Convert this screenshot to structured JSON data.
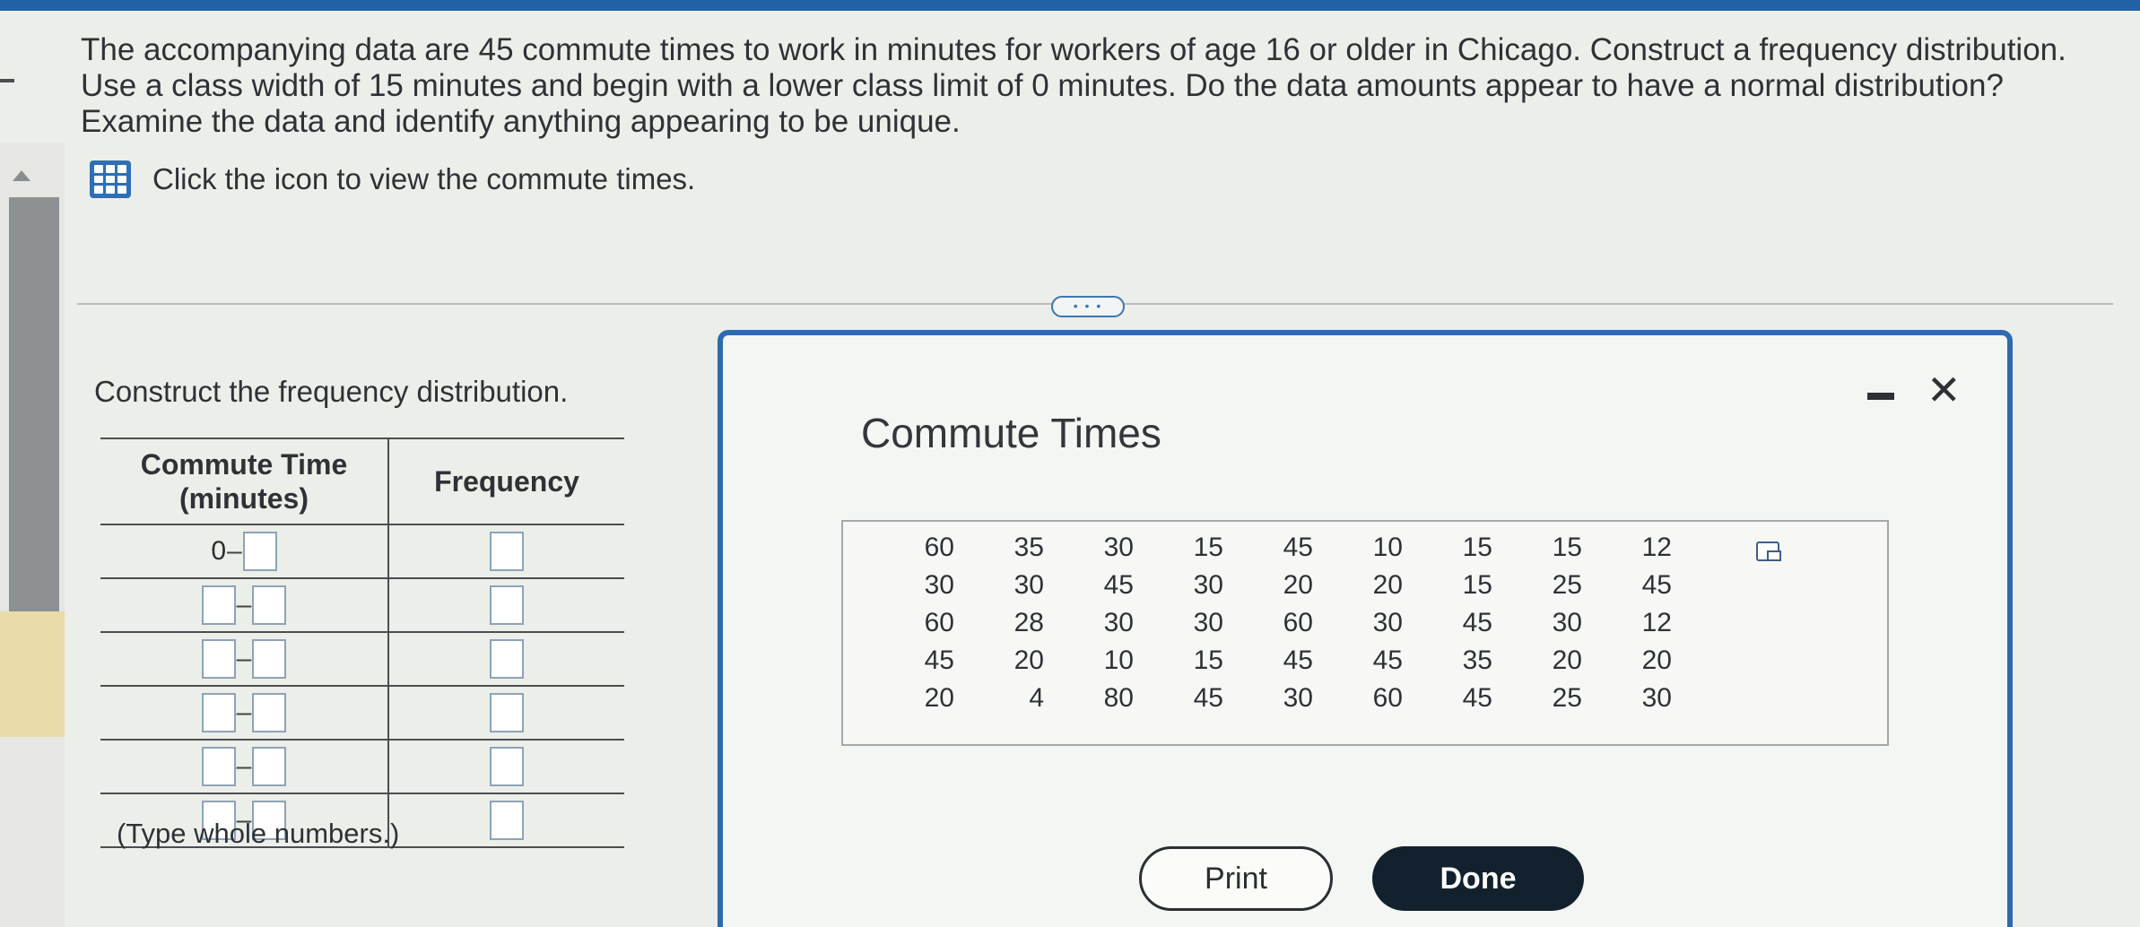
{
  "question": {
    "text": "The accompanying data are 45 commute times to work in minutes for workers of age 16 or older in Chicago. Construct a frequency distribution. Use a class width of 15 minutes and begin with a lower class limit of 0 minutes. Do the data amounts appear to have a normal distribution? Examine the data and identify anything appearing to be unique.",
    "icon_link_text": "Click the icon to view the commute times."
  },
  "more_button_label": "• • •",
  "left_panel": {
    "construct_label": "Construct the frequency distribution.",
    "table_headers": {
      "col1": "Commute Time (minutes)",
      "col2": "Frequency"
    },
    "first_lower_limit": "0",
    "hint": "(Type whole numbers.)"
  },
  "dialog": {
    "title": "Commute Times",
    "minimize_symbol": "–",
    "close_symbol": "✕",
    "rows": [
      [
        "60",
        "35",
        "30",
        "15",
        "45",
        "10",
        "15",
        "15",
        "12"
      ],
      [
        "30",
        "30",
        "45",
        "30",
        "20",
        "20",
        "15",
        "25",
        "45"
      ],
      [
        "60",
        "28",
        "30",
        "30",
        "60",
        "30",
        "45",
        "30",
        "12"
      ],
      [
        "45",
        "20",
        "10",
        "15",
        "45",
        "45",
        "35",
        "20",
        "20"
      ],
      [
        "20",
        "4",
        "80",
        "45",
        "30",
        "60",
        "45",
        "25",
        "30"
      ]
    ],
    "print_label": "Print",
    "done_label": "Done"
  },
  "colors": {
    "accent": "#2d6ab0",
    "done_bg": "#13212e",
    "top_bar": "#1f63a6"
  }
}
